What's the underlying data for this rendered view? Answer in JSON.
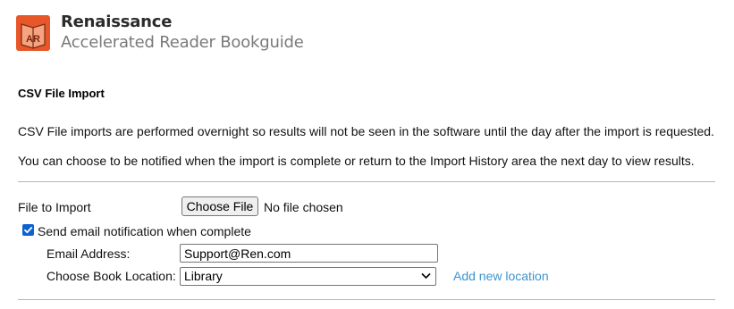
{
  "header": {
    "brand_name": "Renaissance",
    "product_name": "Accelerated Reader Bookguide",
    "logo_text": "AR"
  },
  "page": {
    "title": "CSV File Import",
    "description_1": "CSV File imports are performed overnight so results will not be seen in the software until the day after the import is requested.",
    "description_2": "You can choose to be notified when the import is complete or return to the Import History area the next day to view results."
  },
  "form": {
    "file_label": "File to Import",
    "choose_file_button": "Choose File",
    "no_file_text": "No file chosen",
    "notify_checkbox_label": "Send email notification when complete",
    "notify_checked": true,
    "email_label": "Email Address:",
    "email_value": "Support@Ren.com",
    "location_label": "Choose Book Location:",
    "location_value": "Library",
    "add_location_link": "Add new location"
  },
  "colors": {
    "logo_orange": "#e8572a",
    "link_blue": "#3d93cf",
    "checkbox_blue": "#0b63d1"
  }
}
